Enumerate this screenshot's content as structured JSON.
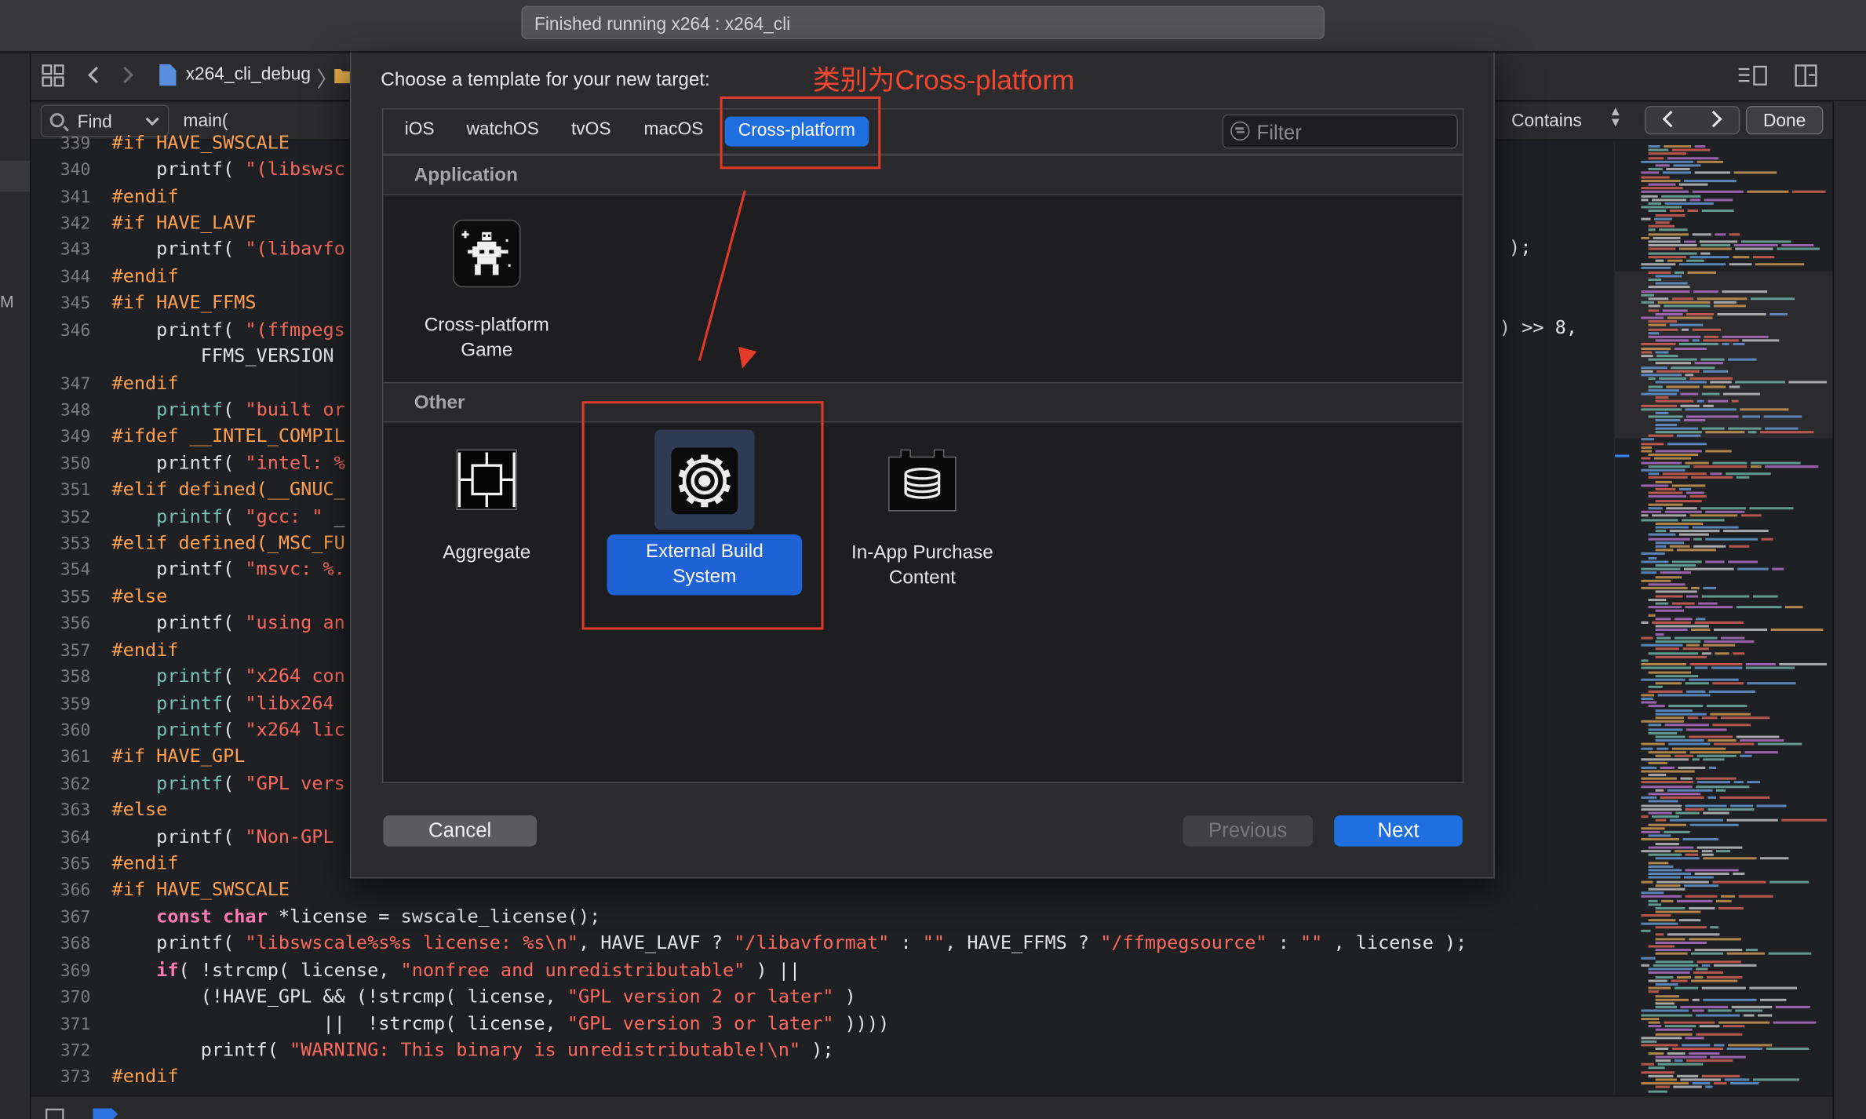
{
  "window": {
    "activity_text": "Finished running x264 : x264_cli"
  },
  "navbar": {
    "scheme": "x264_cli_debug"
  },
  "findbar": {
    "mode": "Find",
    "query": "main(",
    "match_mode": "Contains",
    "done": "Done"
  },
  "editor": {
    "lines": [
      {
        "n": "339",
        "t": "#if HAVE_SWSCALE"
      },
      {
        "n": "340",
        "t": "    printf( \"(libswsc"
      },
      {
        "n": "341",
        "t": "#endif"
      },
      {
        "n": "342",
        "t": "#if HAVE_LAVF"
      },
      {
        "n": "343",
        "t": "    printf( \"(libavfo"
      },
      {
        "n": "344",
        "t": "#endif"
      },
      {
        "n": "345",
        "t": "#if HAVE_FFMS"
      },
      {
        "n": "346",
        "t": "    printf( \"(ffmpegs"
      },
      {
        "n": "",
        "t": "        FFMS_VERSION"
      },
      {
        "n": "347",
        "t": "#endif"
      },
      {
        "n": "348",
        "t": "    printf( \"built or"
      },
      {
        "n": "349",
        "t": "#ifdef __INTEL_COMPIL"
      },
      {
        "n": "350",
        "t": "    printf( \"intel: %"
      },
      {
        "n": "351",
        "t": "#elif defined(__GNUC_"
      },
      {
        "n": "352",
        "t": "    printf( \"gcc: \" _"
      },
      {
        "n": "353",
        "t": "#elif defined(_MSC_FU"
      },
      {
        "n": "354",
        "t": "    printf( \"msvc: %."
      },
      {
        "n": "355",
        "t": "#else"
      },
      {
        "n": "356",
        "t": "    printf( \"using an"
      },
      {
        "n": "357",
        "t": "#endif"
      },
      {
        "n": "358",
        "t": "    printf( \"x264 con"
      },
      {
        "n": "359",
        "t": "    printf( \"libx264 "
      },
      {
        "n": "360",
        "t": "    printf( \"x264 lic"
      },
      {
        "n": "361",
        "t": "#if HAVE_GPL"
      },
      {
        "n": "362",
        "t": "    printf( \"GPL vers"
      },
      {
        "n": "363",
        "t": "#else"
      },
      {
        "n": "364",
        "t": "    printf( \"Non-GPL "
      },
      {
        "n": "365",
        "t": "#endif"
      },
      {
        "n": "366",
        "t": "#if HAVE_SWSCALE"
      },
      {
        "n": "367",
        "t": "    const char *license = swscale_license();"
      },
      {
        "n": "368",
        "t": "    printf( \"libswscale%s%s license: %s\\n\", HAVE_LAVF ? \"/libavformat\" : \"\", HAVE_FFMS ? \"/ffmpegsource\" : \"\" , license );"
      },
      {
        "n": "369",
        "t": "    if( !strcmp( license, \"nonfree and unredistributable\" ) ||"
      },
      {
        "n": "370",
        "t": "        (!HAVE_GPL && (!strcmp( license, \"GPL version 2 or later\" )"
      },
      {
        "n": "371",
        "t": "                   ||  !strcmp( license, \"GPL version 3 or later\" ))))"
      },
      {
        "n": "372",
        "t": "        printf( \"WARNING: This binary is unredistributable!\\n\" );"
      },
      {
        "n": "373",
        "t": "#endif"
      }
    ],
    "right_fragments": [
      ");",
      ") >> 8,"
    ]
  },
  "sheet": {
    "title": "Choose a template for your new target:",
    "annotation": "类别为Cross-platform",
    "tabs": [
      "iOS",
      "watchOS",
      "tvOS",
      "macOS",
      "Cross-platform"
    ],
    "selected_tab": "Cross-platform",
    "filter_placeholder": "Filter",
    "sections": [
      {
        "name": "Application",
        "items": [
          "Cross-platform\nGame"
        ]
      },
      {
        "name": "Other",
        "items": [
          "Aggregate",
          "External Build\nSystem",
          "In-App Purchase\nContent"
        ]
      }
    ],
    "selected_item": "External Build System",
    "buttons": {
      "cancel": "Cancel",
      "previous": "Previous",
      "next": "Next"
    }
  },
  "colors": {
    "accent": "#1f6fe0",
    "annotation": "#e33b2a"
  }
}
